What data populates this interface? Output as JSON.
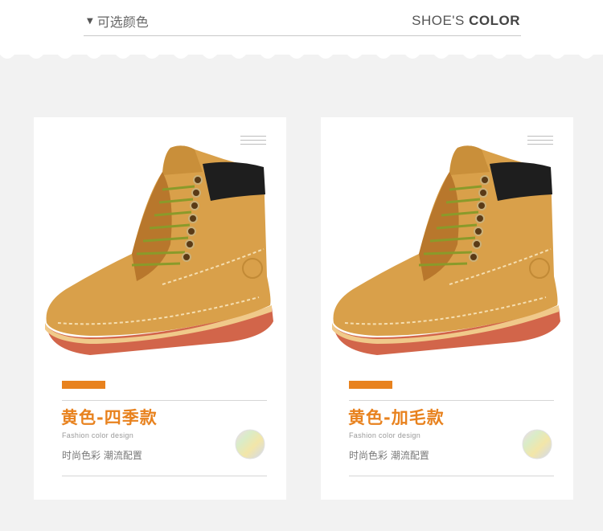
{
  "header": {
    "dropdown_icon": "triangle-down-icon",
    "left_label": "可选颜色",
    "right_label_prefix": "SHOE'S",
    "right_label_bold": "COLOR"
  },
  "cards": [
    {
      "title": "黄色-四季款",
      "subtitle_en": "Fashion  color  design",
      "subtitle_cn": "时尚色彩  潮流配置",
      "icons": [
        "menu-icon",
        "holographic-sticker-icon"
      ]
    },
    {
      "title": "黄色-加毛款",
      "subtitle_en": "Fashion  color  design",
      "subtitle_cn": "时尚色彩  潮流配置",
      "icons": [
        "menu-icon",
        "holographic-sticker-icon"
      ]
    }
  ],
  "colors": {
    "accent": "#e8821e",
    "background": "#f2f2f2",
    "card": "#ffffff",
    "boot_leather": "#d9a04a",
    "boot_sole": "#d2654a",
    "collar": "#1e1e1e"
  }
}
